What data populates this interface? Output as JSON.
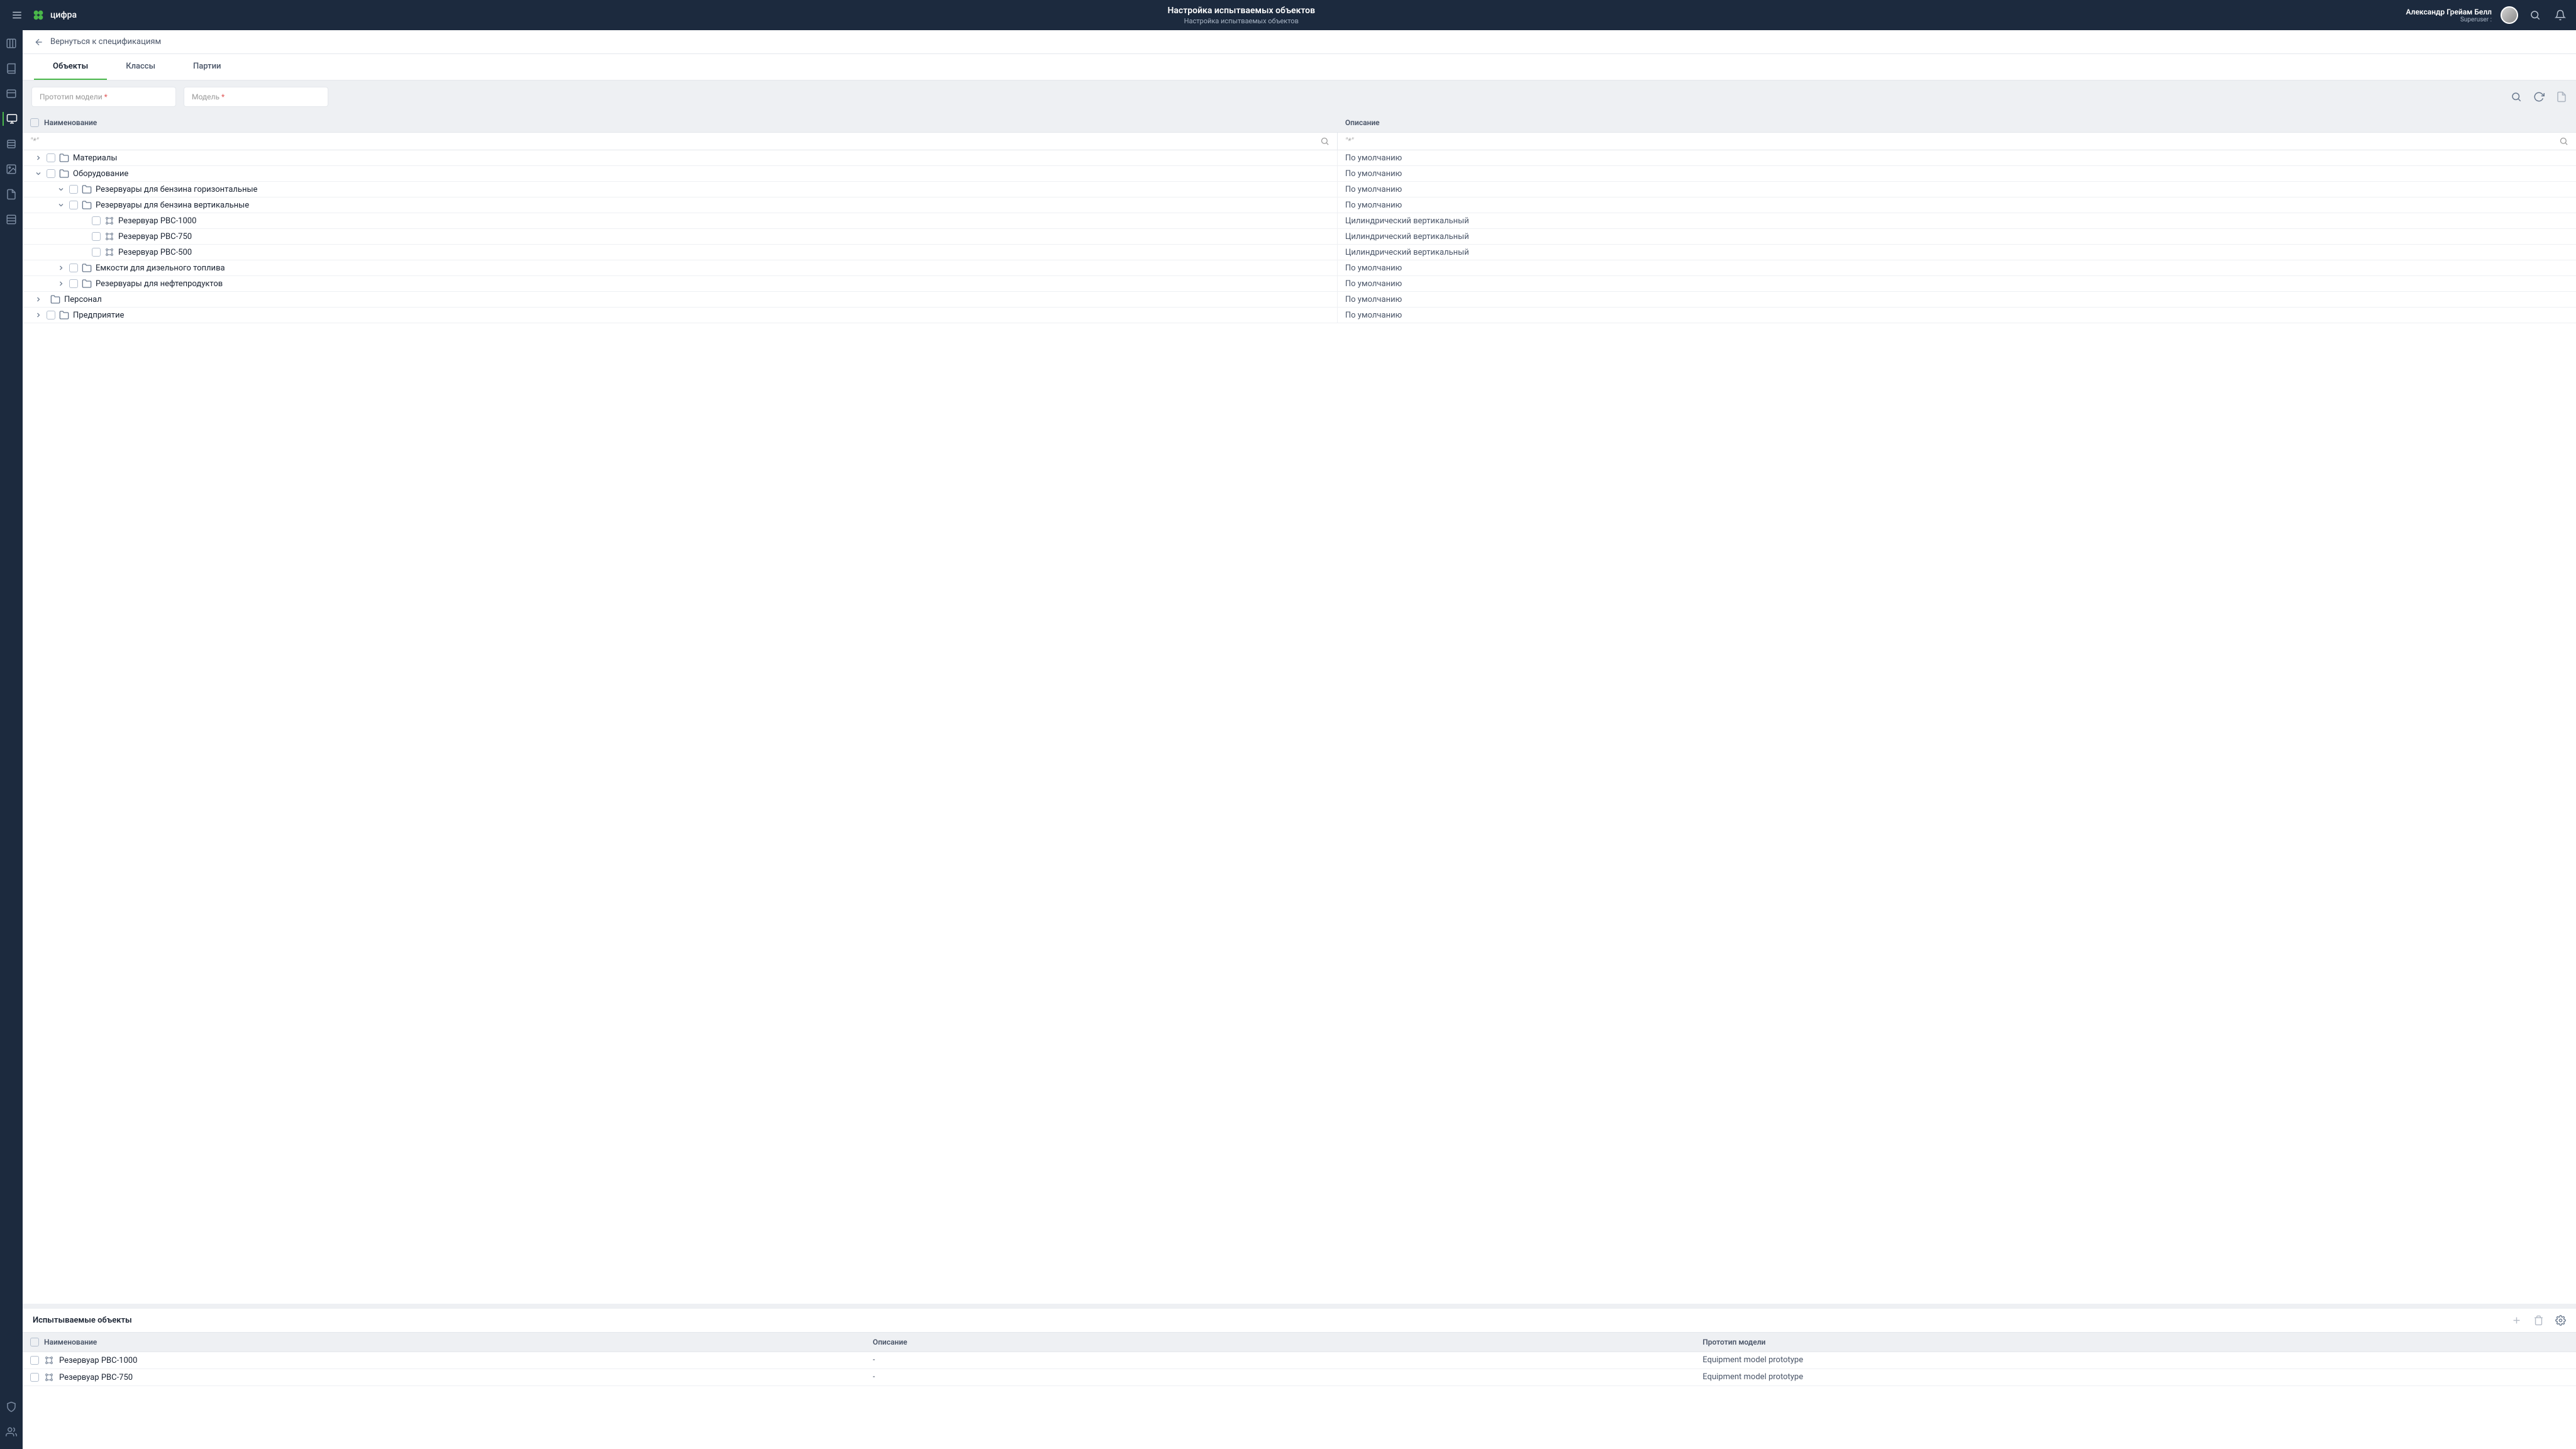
{
  "header": {
    "logo_text": "цифра",
    "title": "Настройка испытваемых объектов",
    "subtitle": "Настройка испытваемых объектов",
    "user_name": "Александр Грейам Белл",
    "user_role": "Superuser :"
  },
  "breadcrumb": {
    "back_label": "Вернуться к спецификациям"
  },
  "tabs": {
    "items": [
      {
        "label": "Объекты",
        "active": true
      },
      {
        "label": "Классы",
        "active": false
      },
      {
        "label": "Партии",
        "active": false
      }
    ]
  },
  "filters": {
    "prototype_label": "Прототип модели",
    "model_label": "Модель"
  },
  "tree_table": {
    "col_name": "Наименование",
    "col_desc": "Описание",
    "search_placeholder": "\"*\"",
    "rows": [
      {
        "level": 0,
        "expand": "closed",
        "icon": "folder",
        "label": "Материалы",
        "desc": "По умолчанию"
      },
      {
        "level": 0,
        "expand": "open",
        "icon": "folder",
        "label": "Оборудование",
        "desc": "По умолчанию"
      },
      {
        "level": 1,
        "expand": "open",
        "icon": "folder",
        "label": "Резервуары для бензина горизонтальные",
        "desc": "По умолчанию"
      },
      {
        "level": 1,
        "expand": "open",
        "icon": "folder",
        "label": "Резервуары для бензина вертикальные",
        "desc": "По умолчанию"
      },
      {
        "level": 2,
        "expand": "none",
        "icon": "item",
        "label": "Резервуар РВС-1000",
        "desc": "Цилиндрический вертикальный"
      },
      {
        "level": 2,
        "expand": "none",
        "icon": "item",
        "label": "Резервуар РВС-750",
        "desc": "Цилиндрический вертикальный"
      },
      {
        "level": 2,
        "expand": "none",
        "icon": "item",
        "label": "Резервуар РВС-500",
        "desc": "Цилиндрический вертикальный"
      },
      {
        "level": 1,
        "expand": "closed",
        "icon": "folder",
        "label": "Емкости для дизельного топлива",
        "desc": "По умолчанию"
      },
      {
        "level": 1,
        "expand": "closed",
        "icon": "folder",
        "label": "Резервуары для нефтепродуктов",
        "desc": "По умолчанию"
      },
      {
        "level": 0,
        "expand": "closed",
        "icon": "folder-nochk",
        "label": "Персонал",
        "desc": "По умолчанию"
      },
      {
        "level": 0,
        "expand": "closed",
        "icon": "folder",
        "label": "Предприятие",
        "desc": "По умолчанию"
      }
    ]
  },
  "bottom": {
    "title": "Испытываемые объекты",
    "col_name": "Наименование",
    "col_desc": "Описание",
    "col_proto": "Прототип модели",
    "rows": [
      {
        "name": "Резервуар РВС-1000",
        "desc": "-",
        "proto": "Equipment model prototype"
      },
      {
        "name": "Резервуар РВС-750",
        "desc": "-",
        "proto": "Equipment model prototype"
      }
    ]
  }
}
